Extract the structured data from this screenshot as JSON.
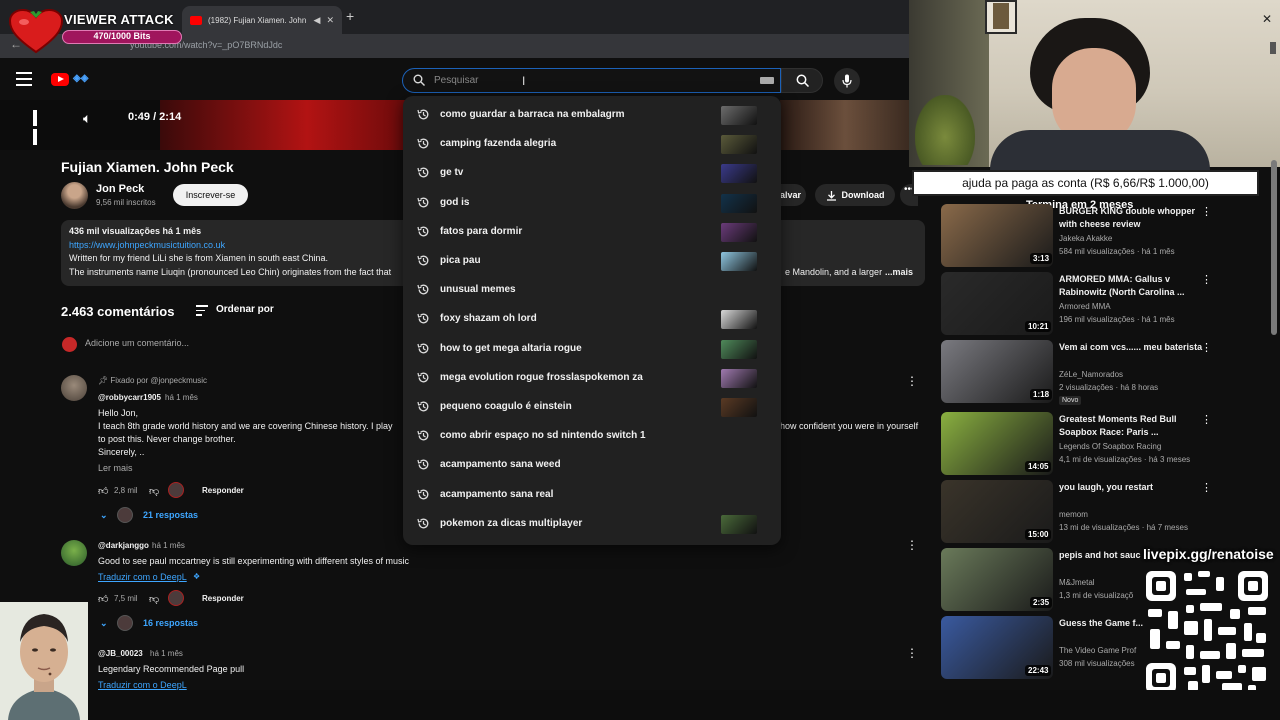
{
  "browser": {
    "tab_title": "(1982) Fujian Xiamen. John",
    "url": "youtube.com/watch?v=_pO7BRNdJdc"
  },
  "overlay": {
    "viewer_attack_title": "VIEWER ATTACK",
    "bits": "470/1000 Bits",
    "goal_text": "ajuda pa paga as conta (R$ 6,66/R$ 1.000,00)",
    "goal_sub": "Termina em 2 meses",
    "livepix": "livepix.gg/renatoise"
  },
  "search": {
    "placeholder": "Pesquisar",
    "suggestions": [
      {
        "text": "como guardar a barraca na embalagrm",
        "thumb": "#6c6c6c"
      },
      {
        "text": "camping fazenda alegria",
        "thumb": "#5a5a3a"
      },
      {
        "text": "ge tv",
        "thumb": "#3a3a8a"
      },
      {
        "text": "god is",
        "thumb": "#12324a"
      },
      {
        "text": "fatos para dormir",
        "thumb": "#6a3b7a"
      },
      {
        "text": "pica pau",
        "thumb": "#8fc6e0"
      },
      {
        "text": "unusual memes",
        "thumb": ""
      },
      {
        "text": "foxy shazam oh lord",
        "thumb": "#d8d8d8"
      },
      {
        "text": "how to get mega altaria rogue",
        "thumb": "#4f8a5a"
      },
      {
        "text": "mega evolution rogue frosslaspokemon za",
        "thumb": "#a07ab0"
      },
      {
        "text": "pequeno coagulo é einstein",
        "thumb": "#5a3a24"
      },
      {
        "text": "como abrir espaço no sd nintendo switch 1",
        "thumb": ""
      },
      {
        "text": "acampamento sana weed",
        "thumb": ""
      },
      {
        "text": "acampamento sana real",
        "thumb": ""
      },
      {
        "text": "pokemon za dicas multiplayer",
        "thumb": "#4a6a3a"
      }
    ]
  },
  "player": {
    "time": "0:49 / 2:14"
  },
  "video": {
    "title": "Fujian Xiamen. John Peck",
    "channel": "Jon Peck",
    "subscribers": "9,56 mil inscritos",
    "subscribe_label": "Inscrever-se",
    "save_label": "alvar",
    "download_label": "Download",
    "more_label": "•••",
    "desc_meta": "436 mil visualizações  há 1 mês",
    "desc_link": "https://www.johnpeckmusictuition.co.uk",
    "desc_line1": "Written for my friend LiLi she is from Xiamen in south east China.",
    "desc_line2": "The instruments name Liuqin (pronounced Leo Chin) originates from the fact that",
    "desc_line2b": "e Mandolin, and a larger",
    "desc_more": "...mais"
  },
  "comments": {
    "count": "2.463 comentários",
    "sort_label": "Ordenar por",
    "add_placeholder": "Adicione um comentário...",
    "items": [
      {
        "pinned": "Fixado por @jonpeckmusic",
        "author": "@robbycarr1905",
        "time": "há 1 mês",
        "lines": [
          "Hello Jon,",
          "I teach 8th grade world history and we are covering Chinese history. I play",
          "to post this. Never change brother.",
          "Sincerely, .."
        ],
        "line_right": "how confident you were in yourself",
        "read_more": "Ler mais",
        "likes": "2,8 mil",
        "reply_label": "Responder",
        "replies": "21 respostas"
      },
      {
        "author": "@darkjanggo",
        "time": "há 1 mês",
        "lines": [
          "Good to see paul mccartney is still experimenting with different styles of music"
        ],
        "translate": "Traduzir com o DeepL",
        "likes": "7,5 mil",
        "reply_label": "Responder",
        "replies": "16 respostas"
      },
      {
        "author": "@JB_00023",
        "time": "há 1 mês",
        "lines": [
          "Legendary Recommended Page pull"
        ],
        "translate": "Traduzir com o DeepL"
      }
    ]
  },
  "recommendations": [
    {
      "title": "BURGER KING double whopper with cheese review",
      "channel": "Jakeka Akakke",
      "meta": "584 mil visualizações · há 1 mês",
      "duration": "3:13",
      "thumb": "#8a6a4a"
    },
    {
      "title": "ARMORED MMA: Gallus v Rabinowitz (North Carolina ...",
      "channel": "Armored MMA",
      "meta": "196 mil visualizações · há 1 mês",
      "duration": "10:21",
      "thumb": "#2a2a2a"
    },
    {
      "title": "Vem ai com vcs...... meu baterista",
      "channel": "ZéLe_Namorados",
      "meta": "2 visualizações · há 8 horas",
      "badge": "Novo",
      "duration": "1:18",
      "thumb": "#7a7a80"
    },
    {
      "title": "Greatest Moments Red Bull Soapbox Race: Paris ...",
      "channel": "Legends Of Soapbox Racing",
      "meta": "4,1 mi de visualizações · há 3 meses",
      "duration": "14:05",
      "thumb": "#8ab040"
    },
    {
      "title": "you laugh, you restart",
      "channel": "memom",
      "meta": "13 mi de visualizações · há 7 meses",
      "duration": "15:00",
      "thumb": "#3a342a"
    },
    {
      "title": "pepis and hot sauc",
      "channel": "M&Jmetal",
      "meta": "1,3 mi de visualizaçõ",
      "duration": "2:35",
      "thumb": "#6a7a5a"
    },
    {
      "title": "Guess the Game f... of Music",
      "channel": "The Video Game Prof",
      "meta": "308 mil visualizações",
      "duration": "22:43",
      "thumb": "#3a5aa0"
    }
  ]
}
